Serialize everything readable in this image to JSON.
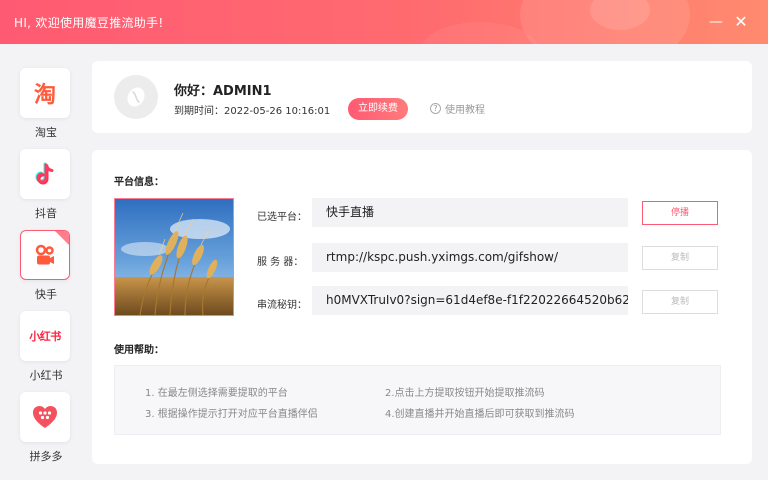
{
  "window": {
    "title": "HI, 欢迎使用魔豆推流助手!",
    "minimize_label": "—",
    "close_label": "✕"
  },
  "sidebar": {
    "items": [
      {
        "label": "淘宝",
        "glyph": "淘",
        "icon": "taobao-icon"
      },
      {
        "label": "抖音",
        "icon": "douyin-icon"
      },
      {
        "label": "快手",
        "icon": "kuaishou-icon",
        "active": true
      },
      {
        "label": "小红书",
        "glyph": "小红书",
        "icon": "xiaohongshu-icon"
      },
      {
        "label": "拼多多",
        "icon": "pinduoduo-icon"
      }
    ]
  },
  "user": {
    "greeting": "你好：ADMIN1",
    "expire_text": "到期时间：2022-05-26 10:16:01",
    "renew_label": "立即续费",
    "tutorial_label": "使用教程"
  },
  "platform": {
    "section_title": "平台信息：",
    "selected_label": "已选平台：",
    "selected_value": "快手直播",
    "server_label": "服 务 器：",
    "server_value": "rtmp://kspc.push.yximgs.com/gifshow/",
    "key_label": "串流秘钥：",
    "key_value": "h0MVXTruIv0?sign=61d4ef8e-f1f22022664520b62",
    "stop_label": "停播",
    "copy_label": "复制"
  },
  "help": {
    "section_title": "使用帮助：",
    "steps": [
      "1. 在最左侧选择需要提取的平台",
      "2.点击上方提取按钮开始提取推流码",
      "3. 根据操作提示打开对应平台直播伴侣",
      "4.创建直播并开始直播后即可获取到推流码"
    ]
  },
  "colors": {
    "accent": "#ff5a73",
    "background": "#f3f3f5"
  }
}
